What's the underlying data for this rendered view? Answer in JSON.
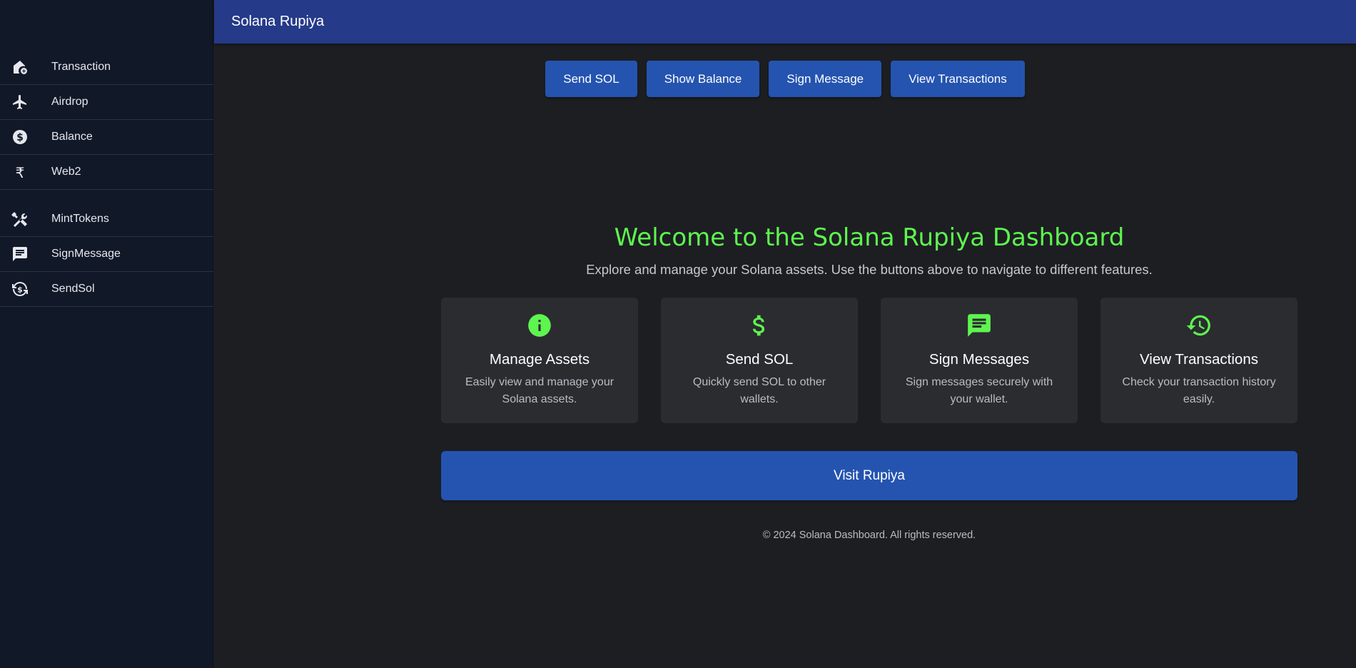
{
  "app": {
    "title": "Solana Rupiya"
  },
  "sidebar": {
    "group1": [
      {
        "label": "Transaction",
        "icon": "house-add-icon"
      },
      {
        "label": "Airdrop",
        "icon": "airplane-icon"
      },
      {
        "label": "Balance",
        "icon": "dollar-circle-icon"
      },
      {
        "label": "Web2",
        "icon": "rupee-icon"
      }
    ],
    "group2": [
      {
        "label": "MintTokens",
        "icon": "tools-icon"
      },
      {
        "label": "SignMessage",
        "icon": "message-icon"
      },
      {
        "label": "SendSol",
        "icon": "currency-exchange-icon"
      }
    ]
  },
  "top_buttons": [
    "Send SOL",
    "Show Balance",
    "Sign Message",
    "View Transactions"
  ],
  "welcome": {
    "title": "Welcome to the Solana Rupiya Dashboard",
    "subtitle": "Explore and manage your Solana assets. Use the buttons above to navigate to different features."
  },
  "cards": [
    {
      "title": "Manage Assets",
      "desc": "Easily view and manage your Solana assets.",
      "icon": "info-icon"
    },
    {
      "title": "Send SOL",
      "desc": "Quickly send SOL to other wallets.",
      "icon": "dollar-icon"
    },
    {
      "title": "Sign Messages",
      "desc": "Sign messages securely with your wallet.",
      "icon": "message-icon"
    },
    {
      "title": "View Transactions",
      "desc": "Check your transaction history easily.",
      "icon": "history-icon"
    }
  ],
  "visit_button": "Visit Rupiya",
  "footer": "© 2024 Solana Dashboard. All rights reserved.",
  "colors": {
    "sidebar_bg": "#111828",
    "appbar_bg": "#253a88",
    "button_bg": "#2454b0",
    "accent_green": "#5ef550",
    "card_bg": "#2b2c30",
    "page_bg": "#1d1e22"
  }
}
